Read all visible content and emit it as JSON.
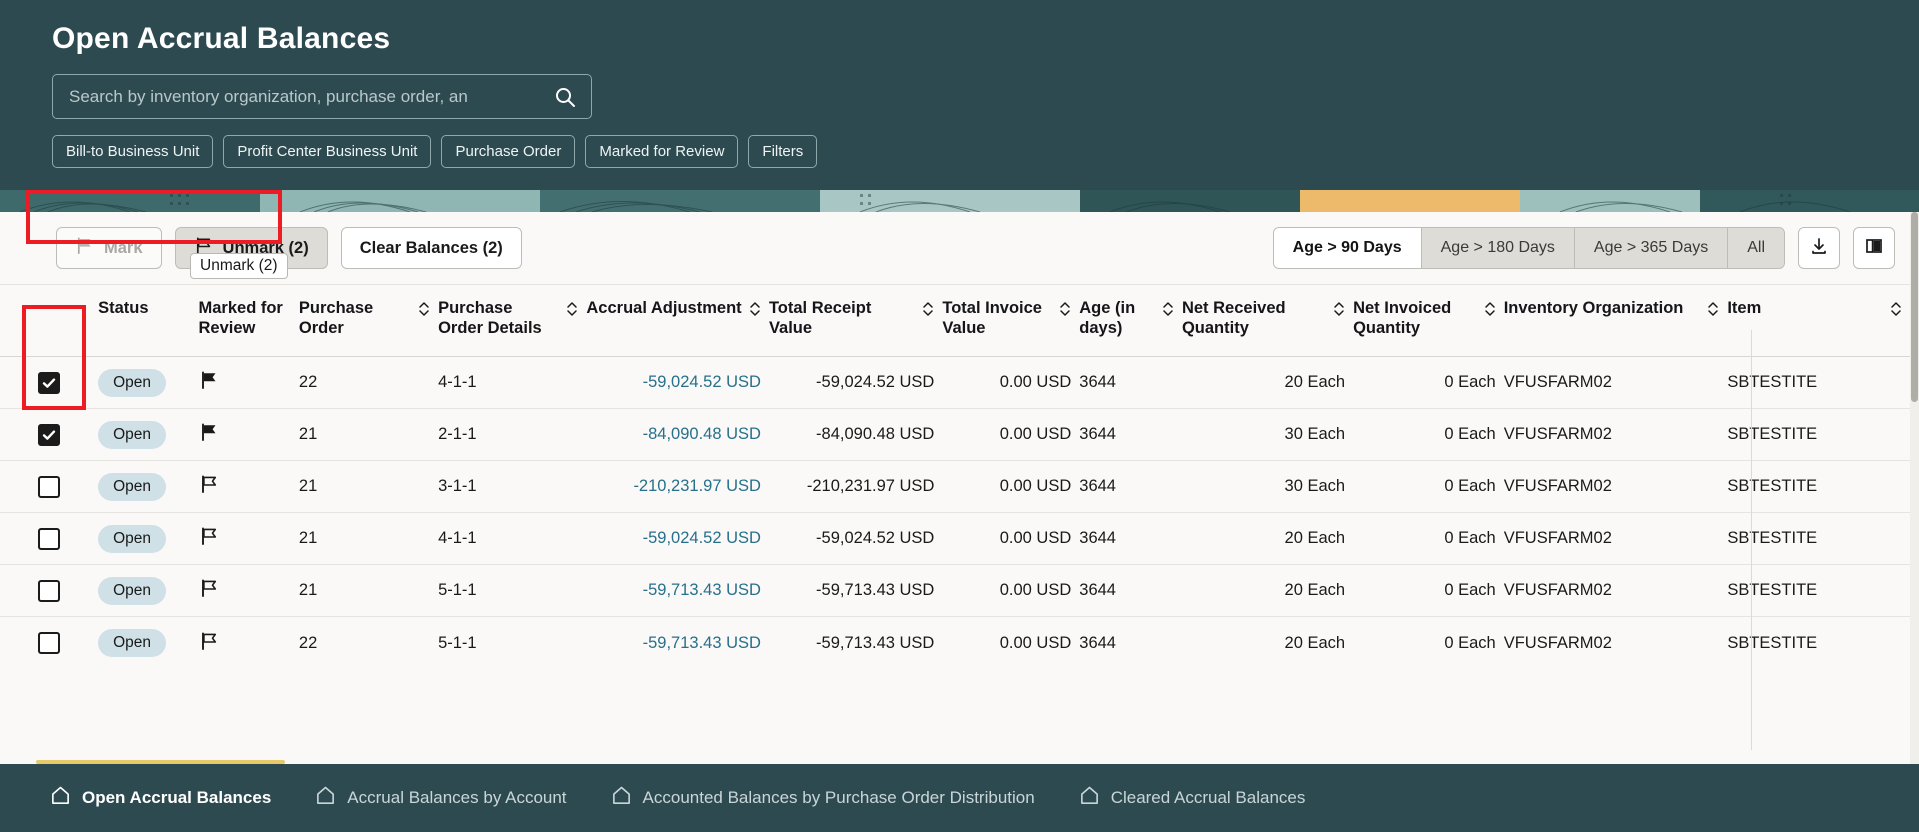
{
  "header": {
    "title": "Open Accrual Balances",
    "search": {
      "placeholder": "Search by inventory organization, purchase order, an",
      "value": "",
      "icon": "search-icon"
    },
    "chips": [
      {
        "label": "Bill-to Business Unit"
      },
      {
        "label": "Profit Center Business Unit"
      },
      {
        "label": "Purchase Order"
      },
      {
        "label": "Marked for Review"
      },
      {
        "label": "Filters"
      }
    ]
  },
  "toolbar": {
    "mark_label": "Mark",
    "mark_icon": "flag-filled-icon",
    "mark_disabled": true,
    "unmark_label": "Unmark (2)",
    "unmark_icon": "flag-outline-icon",
    "clear_label": "Clear Balances (2)",
    "tooltip": "Unmark (2)",
    "age_filters": [
      {
        "label": "Age > 90 Days",
        "active": true
      },
      {
        "label": "Age > 180 Days",
        "active": false
      },
      {
        "label": "Age > 365 Days",
        "active": false
      },
      {
        "label": "All",
        "active": false
      }
    ],
    "download_icon": "download-icon",
    "columns_icon": "columns-layout-icon"
  },
  "table": {
    "columns": [
      {
        "key": "select",
        "label": "",
        "sortable": false
      },
      {
        "key": "status",
        "label": "Status",
        "sortable": false
      },
      {
        "key": "marked",
        "label": "Marked for Review",
        "sortable": false
      },
      {
        "key": "po",
        "label": "Purchase Order",
        "sortable": true
      },
      {
        "key": "pod",
        "label": "Purchase Order Details",
        "sortable": true
      },
      {
        "key": "adjustment",
        "label": "Accrual Adjustment",
        "sortable": true
      },
      {
        "key": "receipt",
        "label": "Total Receipt Value",
        "sortable": true
      },
      {
        "key": "invoice",
        "label": "Total Invoice Value",
        "sortable": true
      },
      {
        "key": "age",
        "label": "Age (in days)",
        "sortable": true
      },
      {
        "key": "received",
        "label": "Net Received Quantity",
        "sortable": true
      },
      {
        "key": "invoiced",
        "label": "Net Invoiced Quantity",
        "sortable": true
      },
      {
        "key": "org",
        "label": "Inventory Organization",
        "sortable": true
      },
      {
        "key": "item",
        "label": "Item",
        "sortable": true
      }
    ],
    "rows": [
      {
        "selected": true,
        "marked": true,
        "status": "Open",
        "po": "22",
        "pod": "4-1-1",
        "adjustment": "-59,024.52 USD",
        "receipt": "-59,024.52 USD",
        "invoice": "0.00 USD",
        "age": "3644",
        "received": "20 Each",
        "invoiced": "0 Each",
        "org": "VFUSFARM02",
        "item": "SBTESTITE"
      },
      {
        "selected": true,
        "marked": true,
        "status": "Open",
        "po": "21",
        "pod": "2-1-1",
        "adjustment": "-84,090.48 USD",
        "receipt": "-84,090.48 USD",
        "invoice": "0.00 USD",
        "age": "3644",
        "received": "30 Each",
        "invoiced": "0 Each",
        "org": "VFUSFARM02",
        "item": "SBTESTITE"
      },
      {
        "selected": false,
        "marked": false,
        "status": "Open",
        "po": "21",
        "pod": "3-1-1",
        "adjustment": "-210,231.97 USD",
        "receipt": "-210,231.97 USD",
        "invoice": "0.00 USD",
        "age": "3644",
        "received": "30 Each",
        "invoiced": "0 Each",
        "org": "VFUSFARM02",
        "item": "SBTESTITE"
      },
      {
        "selected": false,
        "marked": false,
        "status": "Open",
        "po": "21",
        "pod": "4-1-1",
        "adjustment": "-59,024.52 USD",
        "receipt": "-59,024.52 USD",
        "invoice": "0.00 USD",
        "age": "3644",
        "received": "20 Each",
        "invoiced": "0 Each",
        "org": "VFUSFARM02",
        "item": "SBTESTITE"
      },
      {
        "selected": false,
        "marked": false,
        "status": "Open",
        "po": "21",
        "pod": "5-1-1",
        "adjustment": "-59,713.43 USD",
        "receipt": "-59,713.43 USD",
        "invoice": "0.00 USD",
        "age": "3644",
        "received": "20 Each",
        "invoiced": "0 Each",
        "org": "VFUSFARM02",
        "item": "SBTESTITE"
      },
      {
        "selected": false,
        "marked": false,
        "status": "Open",
        "po": "22",
        "pod": "5-1-1",
        "adjustment": "-59,713.43 USD",
        "receipt": "-59,713.43 USD",
        "invoice": "0.00 USD",
        "age": "3644",
        "received": "20 Each",
        "invoiced": "0 Each",
        "org": "VFUSFARM02",
        "item": "SBTESTITE"
      }
    ]
  },
  "bottom_nav": [
    {
      "label": "Open Accrual Balances",
      "icon": "home-icon",
      "active": true
    },
    {
      "label": "Accrual Balances by Account",
      "icon": "home-icon",
      "active": false
    },
    {
      "label": "Accounted Balances by Purchase Order Distribution",
      "icon": "home-icon",
      "active": false
    },
    {
      "label": "Cleared Accrual Balances",
      "icon": "home-icon",
      "active": false
    }
  ],
  "colors": {
    "header_bg": "#2d4a50",
    "content_bg": "#faf9f7",
    "link": "#26708c",
    "badge_bg": "#cfe0e6",
    "annotation": "#ed1c24",
    "active_indicator": "#e8c96a"
  }
}
